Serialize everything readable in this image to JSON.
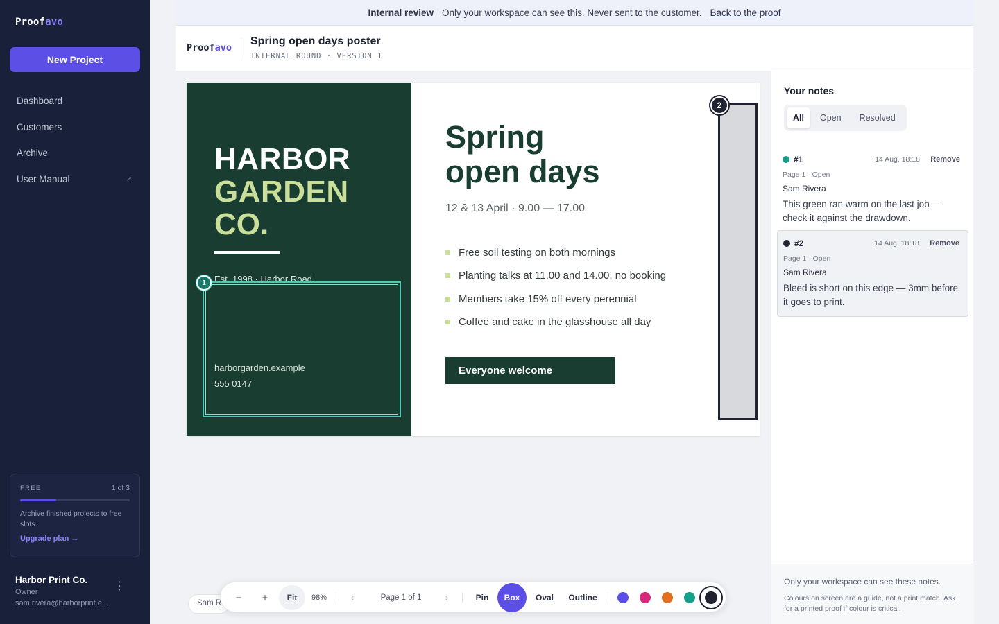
{
  "sidebar": {
    "brand_a": "Proof",
    "brand_b": "avo",
    "new_project": "New Project",
    "nav": [
      {
        "label": "Dashboard"
      },
      {
        "label": "Customers"
      },
      {
        "label": "Archive"
      },
      {
        "label": "User Manual",
        "ext": "↗"
      }
    ],
    "plan": {
      "tier": "FREE",
      "count": "1 of 3",
      "progress": 0.33,
      "text": "Archive finished projects to free slots.",
      "link": "Upgrade plan →"
    },
    "account": {
      "org": "Harbor Print Co.",
      "role": "Owner",
      "email": "sam.rivera@harborprint.e...",
      "menu": "⋮"
    }
  },
  "banner": {
    "label": "Internal review",
    "text": "Only your workspace can see this. Never sent to the customer.",
    "link": "Back to the proof"
  },
  "header": {
    "logo_a": "Proof",
    "logo_b": "avo",
    "title": "Spring open days poster",
    "subtitle": "INTERNAL ROUND · VERSION 1"
  },
  "poster": {
    "brand_line1": "HARBOR",
    "brand_line2": "GARDEN",
    "brand_line3": "CO.",
    "est": "Est. 1998 · Harbor Road",
    "web": "harborgarden.example",
    "phone": "555 0147",
    "title_line1": "Spring",
    "title_line2": "open days",
    "dates": "12 & 13 April  ·  9.00 — 17.00",
    "bullets": [
      "Free soil testing on both mornings",
      "Planting talks at 11.00 and 14.00, no booking",
      "Members take 15% off every perennial",
      "Coffee and cake in the glasshouse all day"
    ],
    "cta": "Everyone welcome",
    "pin1": "1",
    "pin2": "2"
  },
  "toolbar": {
    "author": "Sam Rivera",
    "zoom_out": "−",
    "zoom_in": "+",
    "fit": "Fit",
    "zoom": "98%",
    "prev": "‹",
    "page": "Page 1 of 1",
    "next": "›",
    "pin": "Pin",
    "box": "Box",
    "oval": "Oval",
    "outline": "Outline",
    "colors": [
      "#5b4fe6",
      "#d6287a",
      "#e07020",
      "#16a08a",
      "#1f2230"
    ]
  },
  "notes": {
    "title": "Your notes",
    "tabs": [
      "All",
      "Open",
      "Resolved"
    ],
    "items": [
      {
        "id": "#1",
        "color": "#16a08a",
        "time": "14 Aug, 18:18",
        "remove": "Remove",
        "meta": "Page 1 · Open",
        "author": "Sam Rivera",
        "body": "This green ran warm on the last job — check it against the drawdown."
      },
      {
        "id": "#2",
        "color": "#1f2230",
        "time": "14 Aug, 18:18",
        "remove": "Remove",
        "meta": "Page 1 · Open",
        "author": "Sam Rivera",
        "body": "Bleed is short on this edge — 3mm before it goes to print."
      }
    ],
    "footer_1": "Only your workspace can see these notes.",
    "footer_2": "Colours on screen are a guide, not a print match. Ask for a printed proof if colour is critical."
  }
}
